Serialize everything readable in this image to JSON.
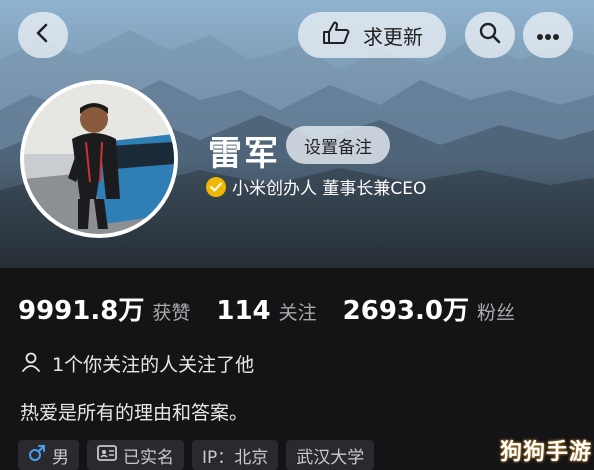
{
  "header": {
    "back_icon": "chevron-left-icon",
    "update_label": "求更新",
    "update_icon": "hand-pointing-icon",
    "search_icon": "search-icon",
    "more_icon": "more-dots-icon"
  },
  "profile": {
    "name": "雷军",
    "remark_label": "设置备注",
    "verified_icon": "verified-check-icon",
    "verified_text": "小米创办人 董事长兼CEO"
  },
  "stats": [
    {
      "value": "9991.8万",
      "label": "获赞"
    },
    {
      "value": "114",
      "label": "关注"
    },
    {
      "value": "2693.0万",
      "label": "粉丝"
    }
  ],
  "mutual": {
    "icon": "person-icon",
    "text": "1个你关注的人关注了他"
  },
  "bio": "热爱是所有的理由和答案。",
  "tags": [
    {
      "icon": "male-icon",
      "label": "男"
    },
    {
      "icon": "id-card-icon",
      "label": "已实名"
    },
    {
      "icon": "",
      "label": "IP：北京"
    },
    {
      "icon": "",
      "label": "武汉大学"
    }
  ],
  "watermark": "狗狗手游",
  "colors": {
    "background": "#141416",
    "verified_badge": "#f2b705",
    "male_icon": "#4a9df0",
    "muted_text": "#a9a9ae"
  }
}
